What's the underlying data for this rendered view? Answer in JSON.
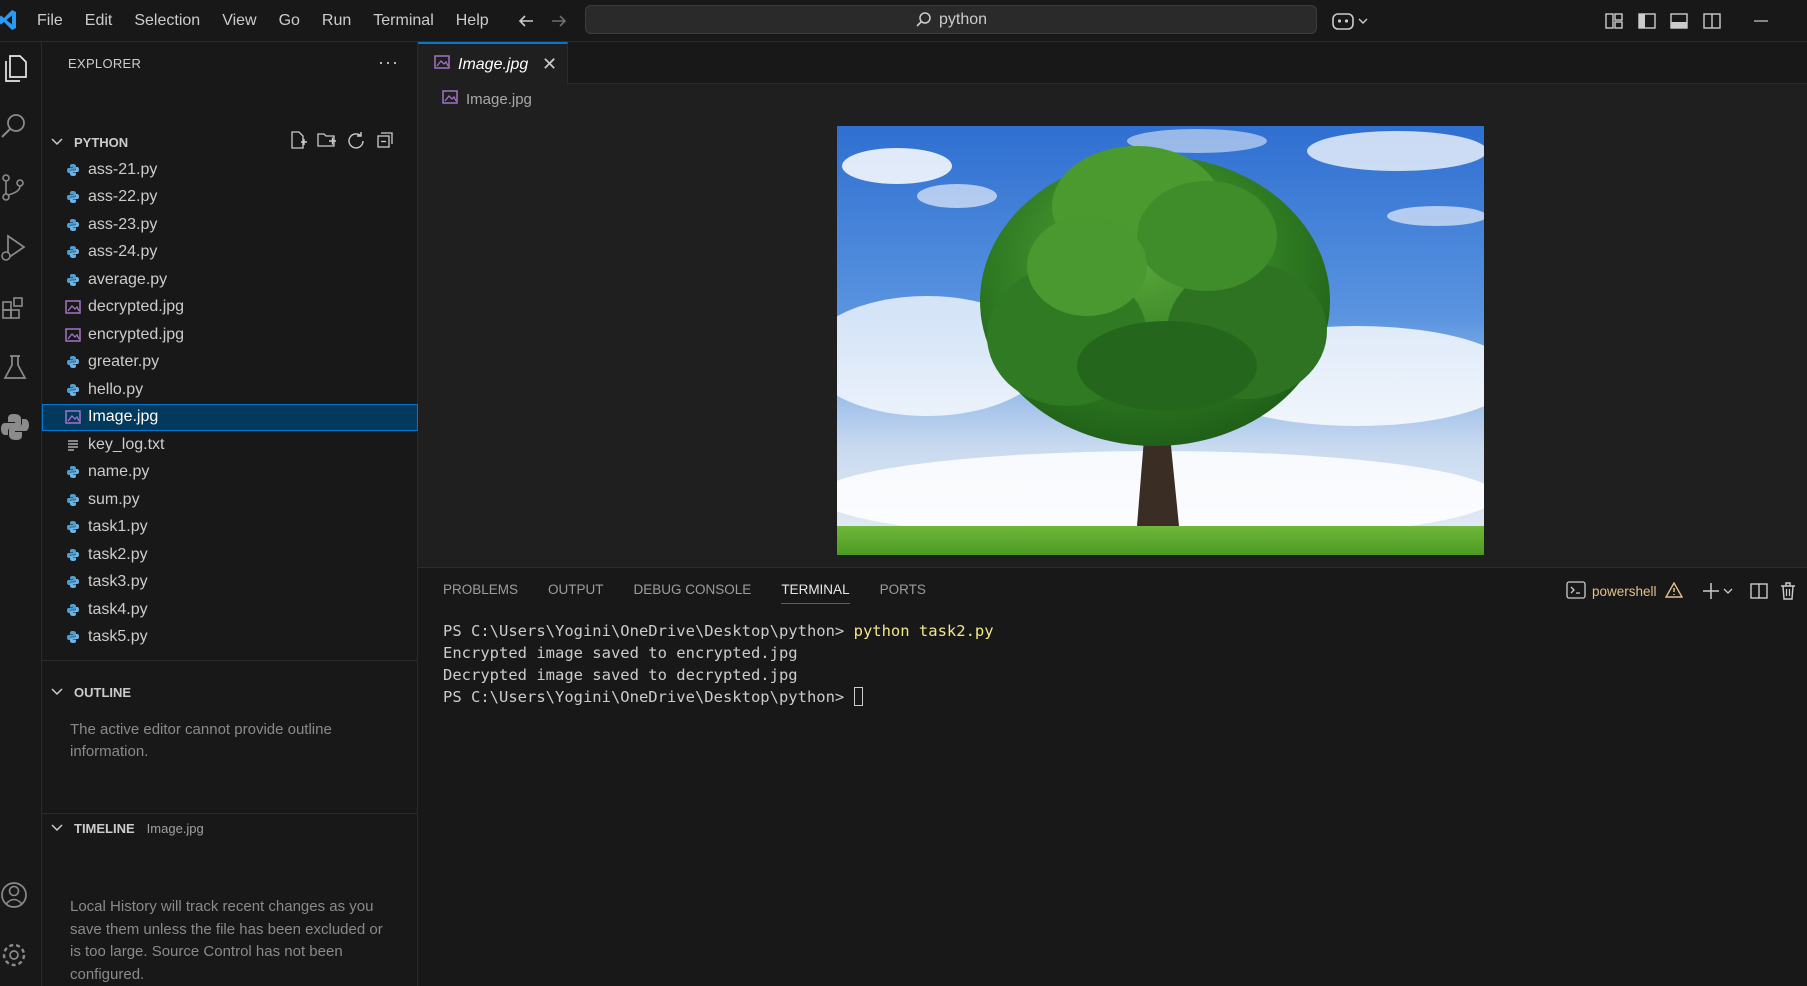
{
  "titlebar": {
    "menu": [
      "File",
      "Edit",
      "Selection",
      "View",
      "Go",
      "Run",
      "Terminal",
      "Help"
    ],
    "search": "python"
  },
  "explorer": {
    "title": "EXPLORER",
    "folder": "PYTHON",
    "files": [
      {
        "name": "ass-21.py",
        "type": "python"
      },
      {
        "name": "ass-22.py",
        "type": "python"
      },
      {
        "name": "ass-23.py",
        "type": "python"
      },
      {
        "name": "ass-24.py",
        "type": "python"
      },
      {
        "name": "average.py",
        "type": "python"
      },
      {
        "name": "decrypted.jpg",
        "type": "image"
      },
      {
        "name": "encrypted.jpg",
        "type": "image"
      },
      {
        "name": "greater.py",
        "type": "python"
      },
      {
        "name": "hello.py",
        "type": "python"
      },
      {
        "name": "Image.jpg",
        "type": "image",
        "selected": true
      },
      {
        "name": "key_log.txt",
        "type": "text"
      },
      {
        "name": "name.py",
        "type": "python"
      },
      {
        "name": "sum.py",
        "type": "python"
      },
      {
        "name": "task1.py",
        "type": "python"
      },
      {
        "name": "task2.py",
        "type": "python"
      },
      {
        "name": "task3.py",
        "type": "python"
      },
      {
        "name": "task4.py",
        "type": "python"
      },
      {
        "name": "task5.py",
        "type": "python"
      }
    ]
  },
  "outline": {
    "title": "OUTLINE",
    "message": "The active editor cannot provide outline information."
  },
  "timeline": {
    "title": "TIMELINE",
    "file": "Image.jpg",
    "message": "Local History will track recent changes as you save them unless the file has been excluded or is too large. Source Control has not been configured."
  },
  "editor": {
    "tab": "Image.jpg",
    "breadcrumb": "Image.jpg"
  },
  "panel": {
    "tabs": [
      "PROBLEMS",
      "OUTPUT",
      "DEBUG CONSOLE",
      "TERMINAL",
      "PORTS"
    ],
    "active_tab": "TERMINAL",
    "shell": "powershell",
    "terminal": {
      "prompt": "PS C:\\Users\\Yogini\\OneDrive\\Desktop\\python> ",
      "command": "python task2.py",
      "output1": "Encrypted image saved to encrypted.jpg",
      "output2": "Decrypted image saved to decrypted.jpg"
    }
  },
  "colors": {
    "accent": "#0078d4",
    "python_icon": "#4b9fd5",
    "image_icon": "#a074c4",
    "shell_warning": "#e2c08d"
  }
}
